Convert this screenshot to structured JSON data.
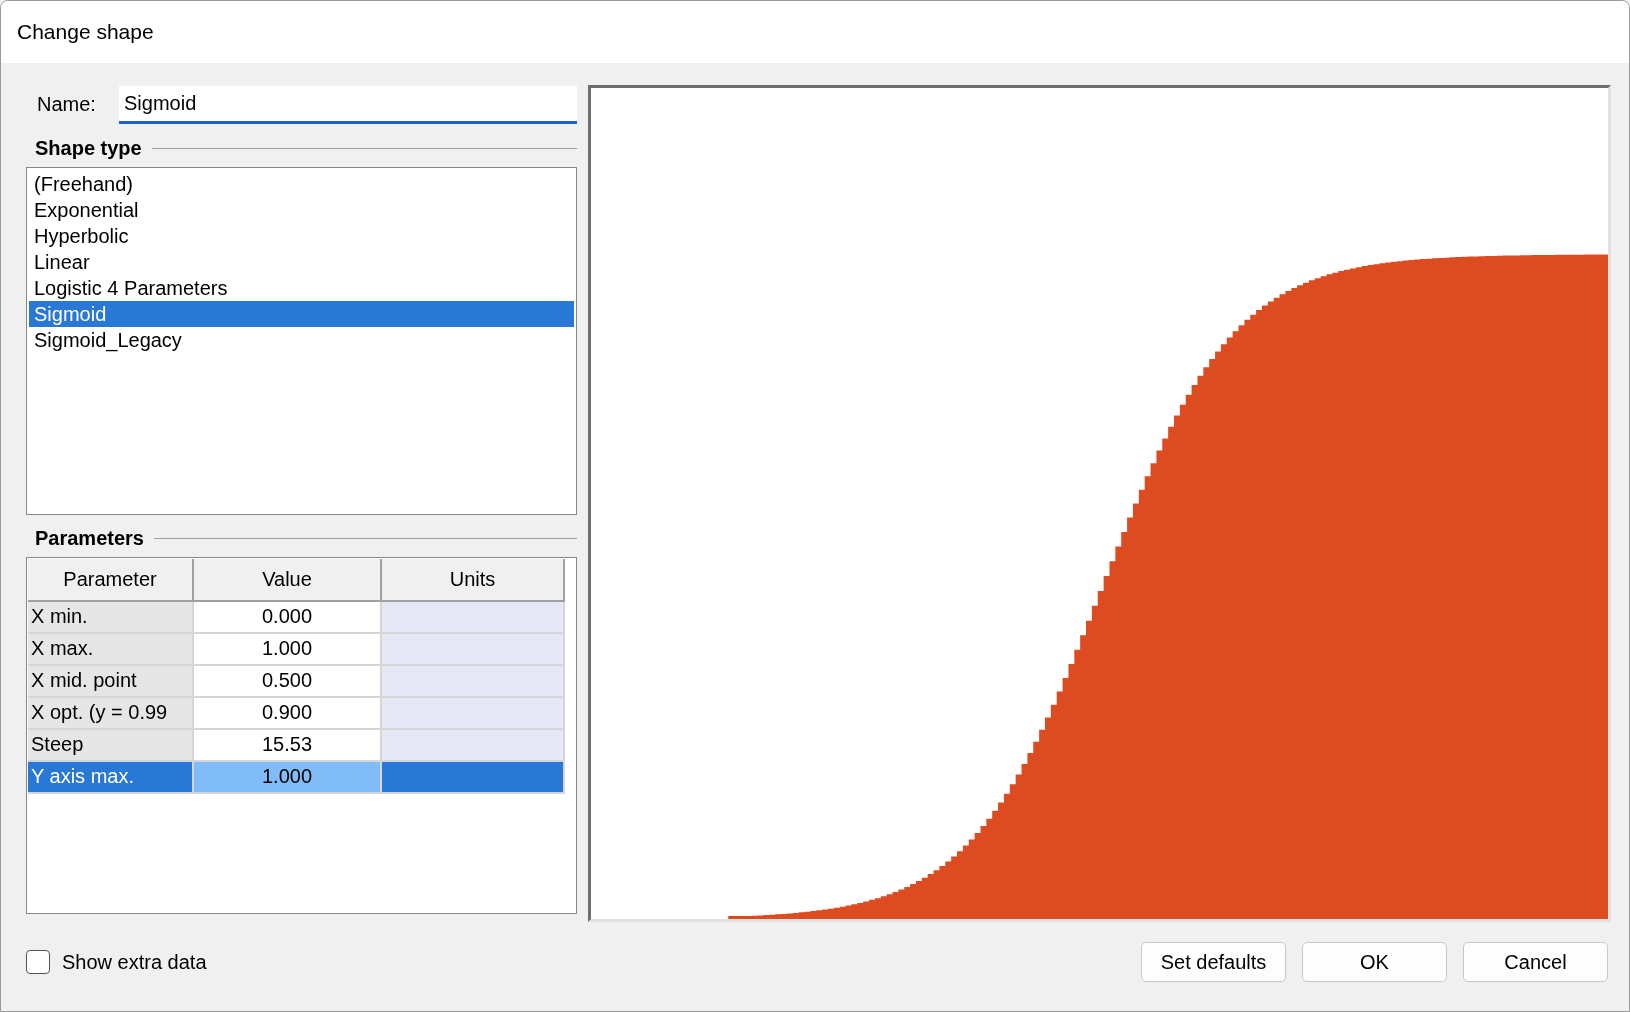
{
  "window": {
    "title": "Change shape"
  },
  "name_field": {
    "label": "Name:",
    "value": "Sigmoid"
  },
  "shape_type": {
    "heading": "Shape type",
    "items": [
      {
        "label": "(Freehand)",
        "selected": false
      },
      {
        "label": "Exponential",
        "selected": false
      },
      {
        "label": "Hyperbolic",
        "selected": false
      },
      {
        "label": "Linear",
        "selected": false
      },
      {
        "label": "Logistic 4 Parameters",
        "selected": false
      },
      {
        "label": "Sigmoid",
        "selected": true
      },
      {
        "label": "Sigmoid_Legacy",
        "selected": false
      }
    ]
  },
  "parameters": {
    "heading": "Parameters",
    "columns": [
      "Parameter",
      "Value",
      "Units"
    ],
    "rows": [
      {
        "parameter": "X min.",
        "value": "0.000",
        "selected": false
      },
      {
        "parameter": "X max.",
        "value": "1.000",
        "selected": false
      },
      {
        "parameter": "X mid. point",
        "value": "0.500",
        "selected": false
      },
      {
        "parameter": "X opt. (y = 0.99",
        "value": "0.900",
        "selected": false
      },
      {
        "parameter": "Steep",
        "value": "15.53",
        "selected": false
      },
      {
        "parameter": "Y axis max.",
        "value": "1.000",
        "selected": true
      }
    ]
  },
  "show_extra_data": {
    "label": "Show extra data",
    "checked": false
  },
  "buttons": [
    "Set defaults",
    "OK",
    "Cancel"
  ]
}
